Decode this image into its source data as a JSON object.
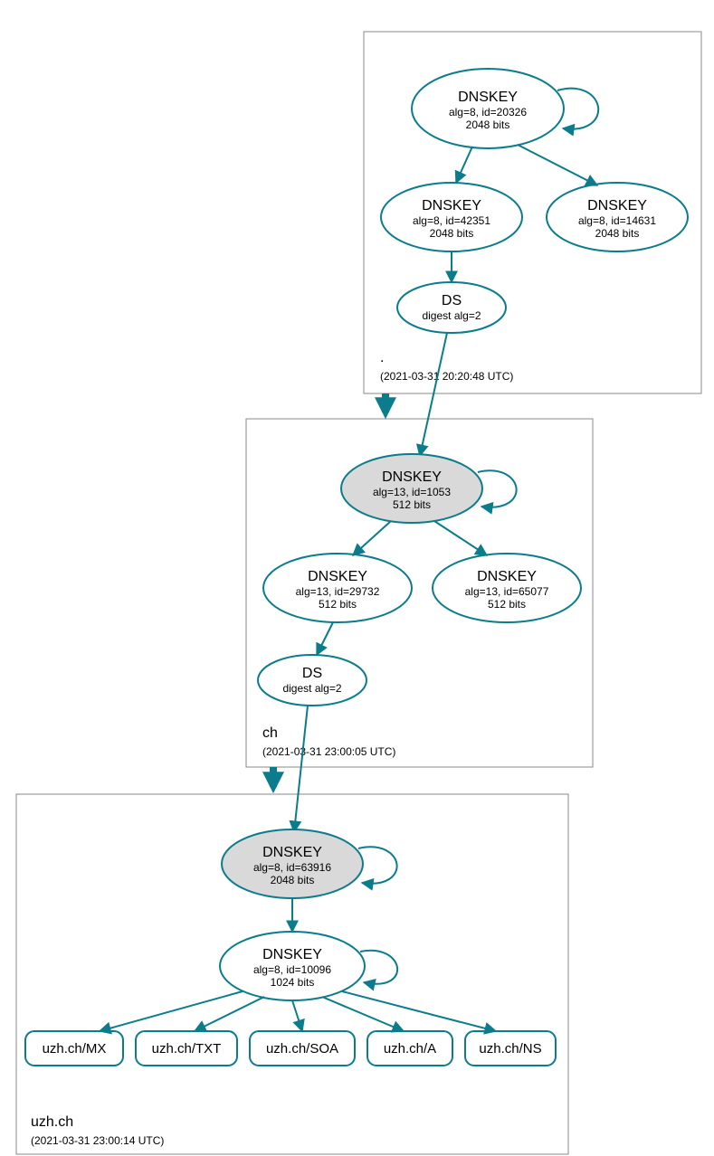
{
  "zones": {
    "root": {
      "label": ".",
      "timestamp": "(2021-03-31 20:20:48 UTC)"
    },
    "ch": {
      "label": "ch",
      "timestamp": "(2021-03-31 23:00:05 UTC)"
    },
    "uzh": {
      "label": "uzh.ch",
      "timestamp": "(2021-03-31 23:00:14 UTC)"
    }
  },
  "nodes": {
    "root_ksk": {
      "title": "DNSKEY",
      "line1": "alg=8, id=20326",
      "line2": "2048 bits"
    },
    "root_zsk1": {
      "title": "DNSKEY",
      "line1": "alg=8, id=42351",
      "line2": "2048 bits"
    },
    "root_zsk2": {
      "title": "DNSKEY",
      "line1": "alg=8, id=14631",
      "line2": "2048 bits"
    },
    "root_ds": {
      "title": "DS",
      "line1": "digest alg=2",
      "line2": ""
    },
    "ch_ksk": {
      "title": "DNSKEY",
      "line1": "alg=13, id=1053",
      "line2": "512 bits"
    },
    "ch_zsk1": {
      "title": "DNSKEY",
      "line1": "alg=13, id=29732",
      "line2": "512 bits"
    },
    "ch_zsk2": {
      "title": "DNSKEY",
      "line1": "alg=13, id=65077",
      "line2": "512 bits"
    },
    "ch_ds": {
      "title": "DS",
      "line1": "digest alg=2",
      "line2": ""
    },
    "uzh_ksk": {
      "title": "DNSKEY",
      "line1": "alg=8, id=63916",
      "line2": "2048 bits"
    },
    "uzh_zsk": {
      "title": "DNSKEY",
      "line1": "alg=8, id=10096",
      "line2": "1024 bits"
    },
    "rr_mx": {
      "label": "uzh.ch/MX"
    },
    "rr_txt": {
      "label": "uzh.ch/TXT"
    },
    "rr_soa": {
      "label": "uzh.ch/SOA"
    },
    "rr_a": {
      "label": "uzh.ch/A"
    },
    "rr_ns": {
      "label": "uzh.ch/NS"
    }
  }
}
